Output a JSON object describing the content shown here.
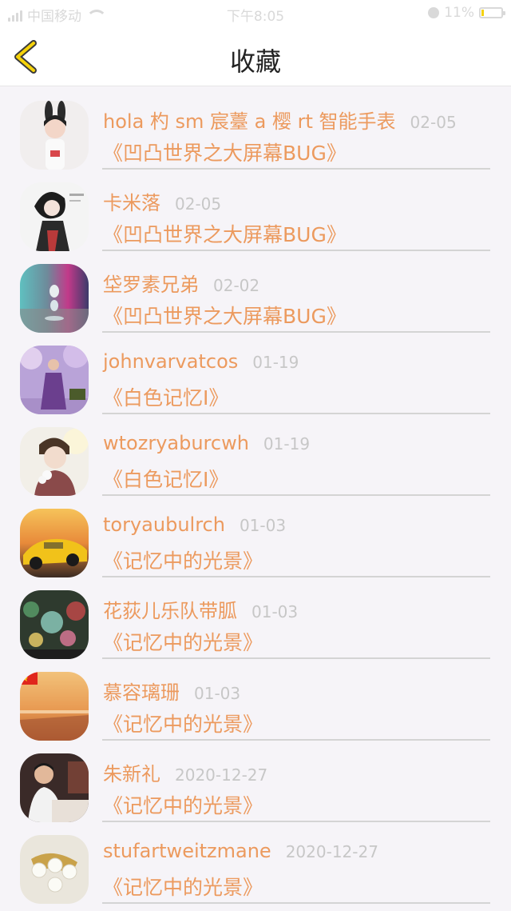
{
  "status_bar": {
    "carrier": "中国移动",
    "time": "下午8:05",
    "battery": "11%",
    "battery_level": 0.11
  },
  "nav": {
    "title": "收藏"
  },
  "items": [
    {
      "name": "hola 杓 sm 宸薹 a 樱 rt 智能手表",
      "date": "02-05",
      "title": "《凹凸世界之大屏幕BUG》"
    },
    {
      "name": "卡米落",
      "date": "02-05",
      "title": "《凹凸世界之大屏幕BUG》"
    },
    {
      "name": "垈罗素兄弟",
      "date": "02-02",
      "title": "《凹凸世界之大屏幕BUG》"
    },
    {
      "name": "johnvarvatcos",
      "date": "01-19",
      "title": "《白色记忆Ⅰ》"
    },
    {
      "name": "wtozryaburcwh",
      "date": "01-19",
      "title": "《白色记忆Ⅰ》"
    },
    {
      "name": "toryaubulrch",
      "date": "01-03",
      "title": "《记忆中的光景》"
    },
    {
      "name": "花荻儿乐队带胍",
      "date": "01-03",
      "title": "《记忆中的光景》"
    },
    {
      "name": "慕容璃珊",
      "date": "01-03",
      "title": "《记忆中的光景》"
    },
    {
      "name": "朱新礼",
      "date": "2020-12-27",
      "title": "《记忆中的光景》"
    },
    {
      "name": "stufartweitzmane",
      "date": "2020-12-27",
      "title": "《记忆中的光景》"
    }
  ]
}
